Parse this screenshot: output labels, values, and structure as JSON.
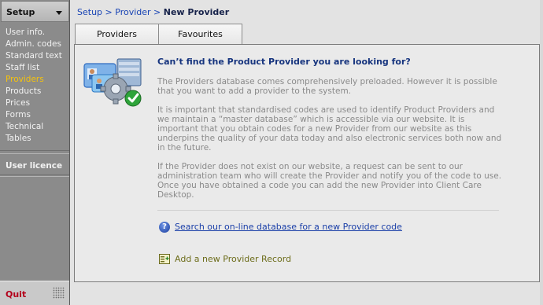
{
  "sidebar": {
    "title": "Setup",
    "items": [
      {
        "label": "User info.",
        "active": false
      },
      {
        "label": "Admin. codes",
        "active": false
      },
      {
        "label": "Standard text",
        "active": false
      },
      {
        "label": "Staff list",
        "active": false
      },
      {
        "label": "Providers",
        "active": true
      },
      {
        "label": "Products",
        "active": false
      },
      {
        "label": "Prices",
        "active": false
      },
      {
        "label": "Forms",
        "active": false
      },
      {
        "label": "Technical",
        "active": false
      },
      {
        "label": "Tables",
        "active": false
      }
    ],
    "licence_label": "User licence",
    "quit_label": "Quit"
  },
  "breadcrumb": {
    "crumbs": [
      "Setup",
      "Provider"
    ],
    "separator": ">",
    "current": "New Provider"
  },
  "tabs": [
    {
      "label": "Providers"
    },
    {
      "label": "Favourites"
    }
  ],
  "content": {
    "heading": "Can’t find the Product Provider you are looking for?",
    "paragraphs": [
      "The Providers database comes comprehensively preloaded. However it is possible that you want to add a provider to the system.",
      "It is important that standardised codes are used to identify Product Providers and we maintain a “master database” which is accessible via our website. It is important that you obtain codes for a new Provider from our website as this underpins the quality of your data today and also electronic services both now and in the future.",
      "If the Provider does not exist on our website, a request can be sent to our administration team who will create the Provider and notify you of the code to use.  Once you have obtained a code you can add the new Provider into Client Care Desktop."
    ],
    "search_link": "Search our on-line database for a new Provider code",
    "add_link": "Add a new Provider Record"
  },
  "icons": {
    "sidebar_caret": "caret-down-icon",
    "grip": "resize-grip-icon",
    "illustration": "provider-database-settings-icon",
    "search": "help-question-icon",
    "add": "add-record-icon"
  },
  "colors": {
    "sidebar_bg": "#8b8b8b",
    "active_item": "#f4c20d",
    "quit": "#b3001b",
    "link": "#1a3fa8",
    "heading": "#16347e"
  }
}
